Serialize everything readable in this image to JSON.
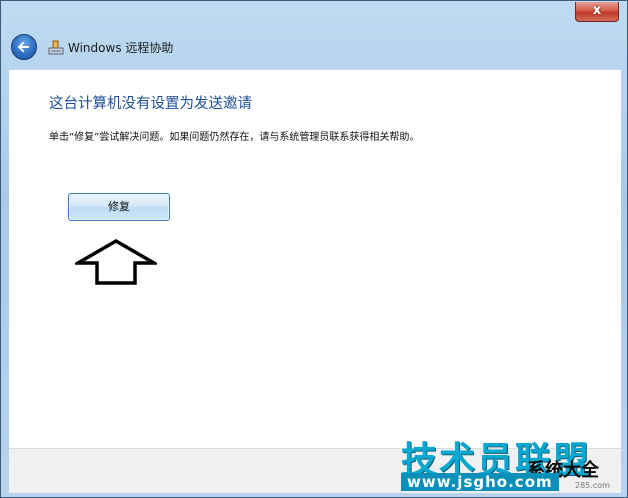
{
  "window": {
    "title": "Windows 远程协助",
    "close_glyph": "x"
  },
  "content": {
    "heading": "这台计算机没有设置为发送邀请",
    "description": "单击“修复”尝试解决问题。如果问题仍然存在，请与系统管理员联系获得相关帮助。",
    "repair_button_label": "修复"
  },
  "watermark": {
    "main_text": "技术员联盟",
    "url_text": "www.jsgho.com",
    "side_text": "系统大全",
    "small_text": "285.com"
  },
  "colors": {
    "heading": "#1e4e9c",
    "title_bar": "#bfdbf3",
    "close_button": "#c0392b",
    "watermark": "#0aa8d0"
  },
  "icons": {
    "back": "back-arrow-icon",
    "app": "remote-assistance-icon",
    "close": "close-icon",
    "pointer": "up-arrow-icon"
  }
}
